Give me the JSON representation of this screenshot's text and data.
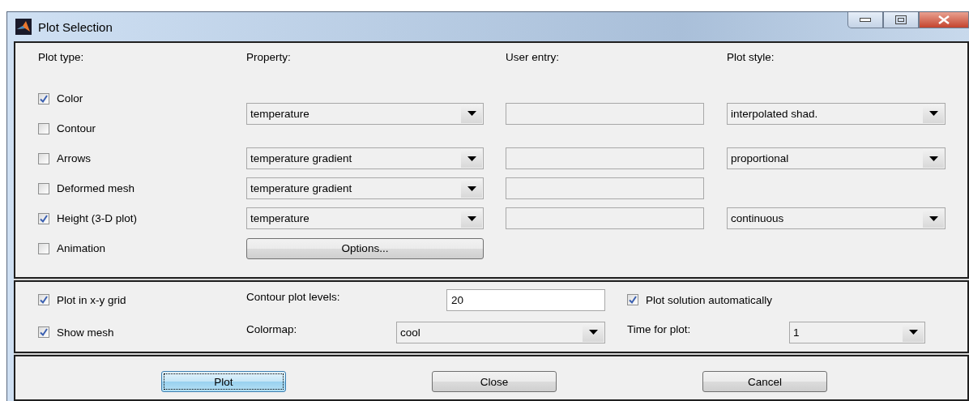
{
  "window": {
    "title": "Plot Selection"
  },
  "headers": [
    "Plot type:",
    "Property:",
    "User entry:",
    "Plot style:"
  ],
  "plot_rows": [
    {
      "kind": "dropdowns",
      "types": [
        {
          "label": "Color",
          "checked": true
        },
        {
          "label": "Contour",
          "checked": false
        }
      ],
      "property": "temperature",
      "user_entry_field": true,
      "plot_style": "interpolated shad."
    },
    {
      "kind": "dropdowns",
      "types": [
        {
          "label": "Arrows",
          "checked": false
        }
      ],
      "property": "temperature gradient",
      "user_entry_field": true,
      "plot_style": "proportional"
    },
    {
      "kind": "dropdowns",
      "types": [
        {
          "label": "Deformed mesh",
          "checked": false
        }
      ],
      "property": "temperature gradient",
      "user_entry_field": true
    },
    {
      "kind": "dropdowns",
      "types": [
        {
          "label": "Height (3-D plot)",
          "checked": true
        }
      ],
      "property": "temperature",
      "user_entry_field": true,
      "plot_style": "continuous"
    },
    {
      "kind": "button",
      "types": [
        {
          "label": "Animation",
          "checked": false
        }
      ],
      "button": "Options..."
    }
  ],
  "options": {
    "plot_in_grid": {
      "label": "Plot in x-y grid",
      "checked": true
    },
    "show_mesh": {
      "label": "Show mesh",
      "checked": true
    },
    "contour_levels": {
      "label": "Contour plot levels:",
      "value": "20"
    },
    "colormap": {
      "label": "Colormap:",
      "value": "cool"
    },
    "auto_plot": {
      "label": "Plot solution automatically",
      "checked": true
    },
    "time_for_plot": {
      "label": "Time for plot:",
      "value": "1"
    }
  },
  "buttons": [
    {
      "label": "Plot",
      "focused": true
    },
    {
      "label": "Close",
      "focused": false
    },
    {
      "label": "Cancel",
      "focused": false
    }
  ]
}
